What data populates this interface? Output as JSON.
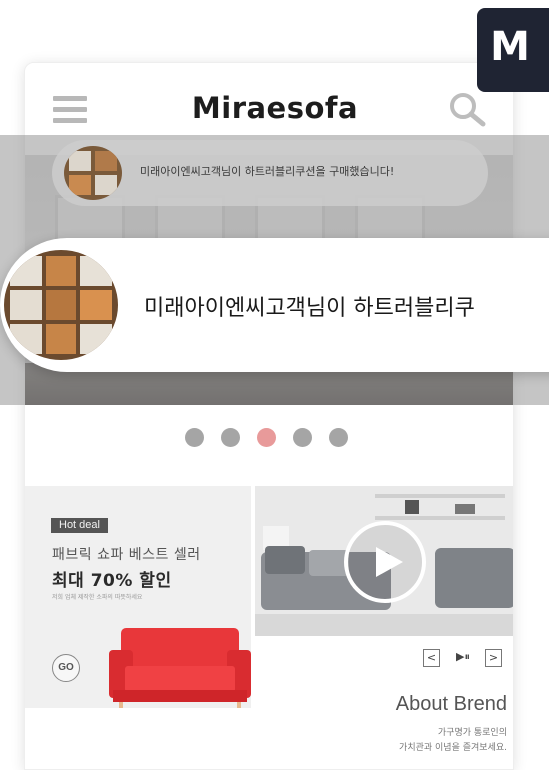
{
  "header": {
    "brand": "Miraesofa",
    "badge_letter": "M"
  },
  "notification": {
    "small_text": "미래아이엔씨고객님이 하트러블리쿠션을 구매했습니다!",
    "large_text": "미래아이엔씨고객님이 하트러블리쿠"
  },
  "slider": {
    "dot_count": 5,
    "active_index": 2
  },
  "promo": {
    "badge": "Hot deal",
    "subtitle": "패브릭 쇼파 베스트 셀러",
    "headline": "최대 70% 할인",
    "note": "저희 업체 제작한 소파의 따뜻하세요",
    "go_label": "GO",
    "sofa_color": "#e8373a"
  },
  "video": {
    "prev_label": "<",
    "playpause_label": "▶⏸",
    "next_label": ">"
  },
  "about": {
    "title": "About Brend",
    "line1": "가구명가 통로인의",
    "line2": "가치관과 이념을 즐겨보세요."
  },
  "colors": {
    "badge_bg": "#1f2433",
    "dot_active": "#e89a9a",
    "dot_inactive": "#a5a5a5"
  }
}
